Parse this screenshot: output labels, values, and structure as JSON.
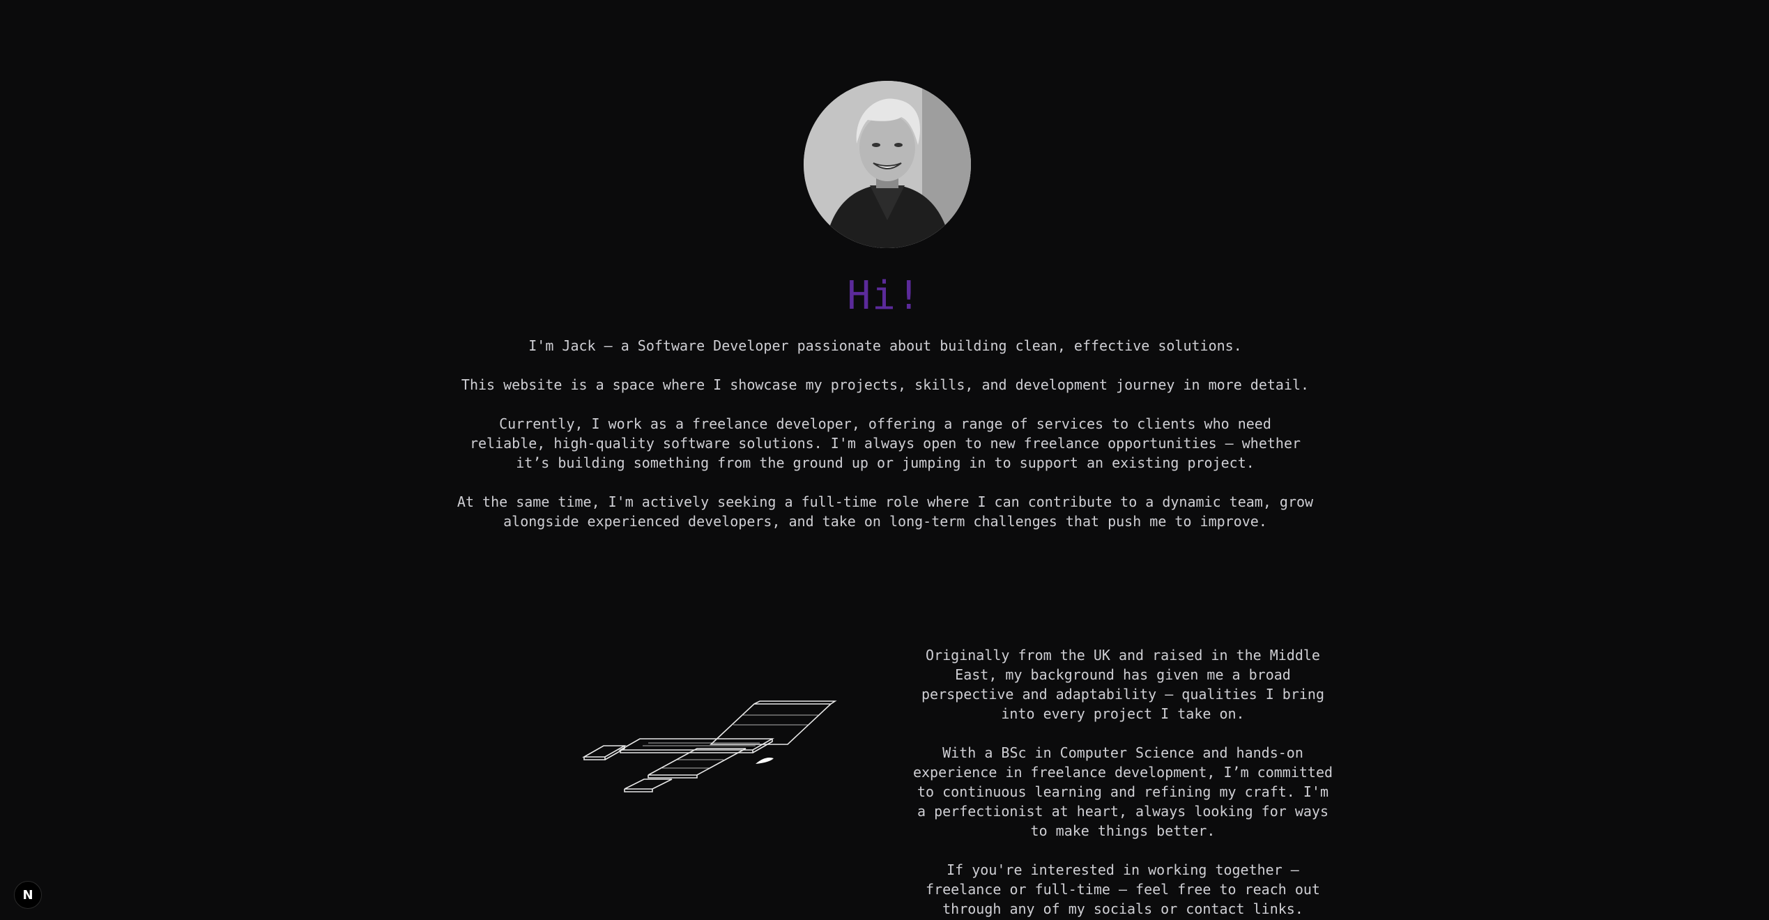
{
  "profile": {
    "avatar_icon": "profile-photo",
    "greeting": "Hi!"
  },
  "intro": {
    "p1": "I'm Jack – a Software Developer passionate about building clean, effective solutions.",
    "p2": "This website is a space where I showcase my projects, skills, and development journey in more detail.",
    "p3": "Currently, I work as a freelance developer, offering a range of services to clients who need reliable, high-quality software solutions. I'm always open to new freelance opportunities – whether it’s building something from the ground up or jumping in to support an existing project.",
    "p4": "At the same time, I'm actively seeking a full-time role where I can contribute to a dynamic team, grow alongside experienced developers, and take on long-term challenges that push me to improve."
  },
  "about": {
    "p1": "Originally from the UK and raised in the Middle East, my background has given me a broad perspective and adaptability – qualities I bring into every project I take on.",
    "p2": "With a BSc in Computer Science and hands-on experience in freelance development, I’m committed to continuous learning and refining my craft. I'm a perfectionist at heart, always looking for ways to make things better.",
    "p3": "If you're interested in working together – freelance or full-time – feel free to reach out through any of my socials or contact links."
  },
  "badge": {
    "label": "N",
    "icon": "nextjs-dev-indicator-icon"
  },
  "colors": {
    "background": "#0b0b0c",
    "greeting": "#5b2a9a",
    "text": "#cfcfd4"
  }
}
